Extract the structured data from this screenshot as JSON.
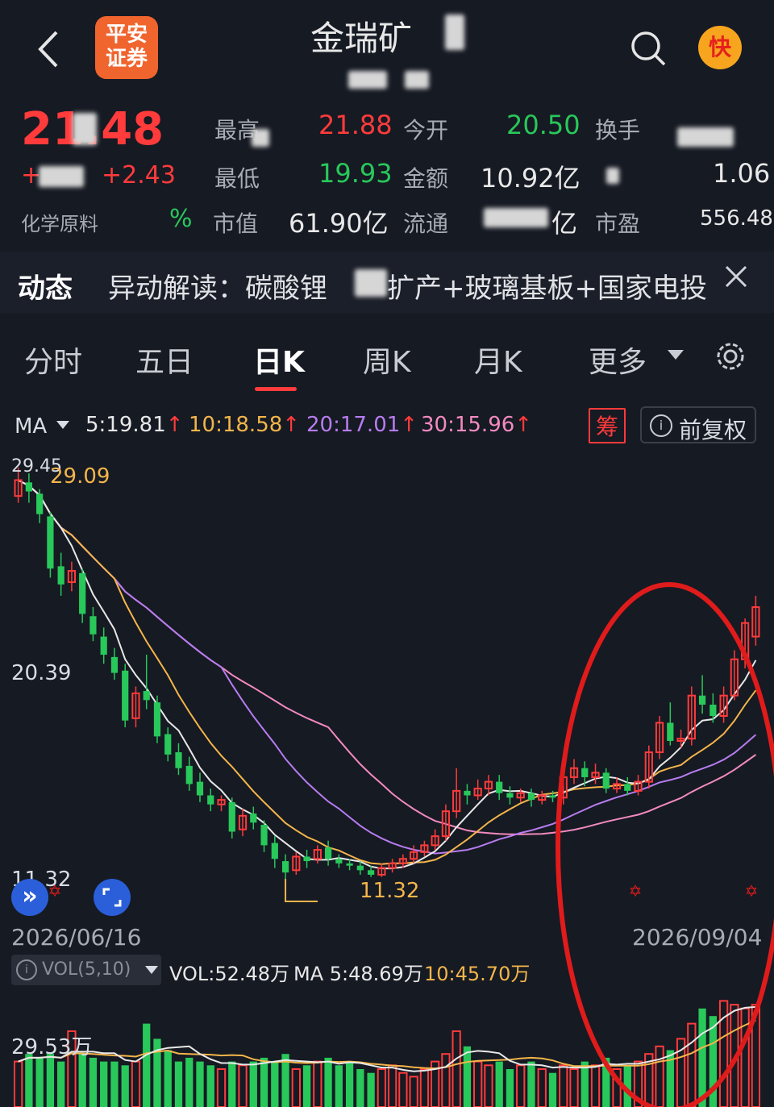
{
  "header": {
    "back_icon": "chevron-left-icon",
    "broker_logo_text": "平安\n证券",
    "title": "金瑞矿",
    "search_icon": "search-icon",
    "fast_badge": "快"
  },
  "quote": {
    "price": "21.48",
    "change": "+2.43",
    "industry": "化学原料",
    "industry_change": "%",
    "high_label": "最高",
    "high_value": "21.88",
    "low_label": "最低",
    "low_value": "19.93",
    "market_cap_label": "市值",
    "market_cap_value": "61.90亿",
    "open_label": "今开",
    "open_value": "20.50",
    "amount_label": "金额",
    "amount_value": "10.92亿",
    "float_label": "流通",
    "float_value": "亿",
    "turnover_label": "换手",
    "ratio_value": "1.06",
    "pe_label": "市盈",
    "pe_value": "556.48"
  },
  "news": {
    "label": "动态",
    "text": "异动解读：碳酸锂",
    "text2": "扩产+玻璃基板+国家电投",
    "close_icon": "close-icon"
  },
  "tabs": [
    {
      "label": "分时"
    },
    {
      "label": "五日"
    },
    {
      "label": "日K"
    },
    {
      "label": "周K"
    },
    {
      "label": "月K"
    },
    {
      "label": "更多"
    }
  ],
  "settings_icon": "gear-icon",
  "ma_bar": {
    "label": "MA",
    "ma5": "5:19.81",
    "ma10": "10:18.58",
    "ma20": "20:17.01",
    "ma30": "30:15.96",
    "chip_button": "筹",
    "adjust_button": "前复权",
    "colors": {
      "ma5": "#e8e8e8",
      "ma10": "#f4b54a",
      "ma20": "#b77cf0",
      "ma30": "#f38ac0"
    }
  },
  "chart_labels": {
    "top_value": "29.45",
    "high_marker": "29.09",
    "mid_axis": "20.39",
    "bottom_axis": "11.32",
    "low_marker": "11.32",
    "start_date": "2026/06/16",
    "end_date": "2026/09/04"
  },
  "volume_bar": {
    "indicator": "VOL(5,10)",
    "vol": "VOL:52.48万",
    "ma5": "MA 5:48.69万",
    "ma10": "10:45.70万",
    "axis_top": "29.53万"
  },
  "chart_data": {
    "type": "candlestick",
    "ylim": [
      11.32,
      29.45
    ],
    "candles": [
      {
        "o": 28.2,
        "c": 28.9,
        "h": 29.45,
        "l": 27.9
      },
      {
        "o": 28.8,
        "c": 28.4,
        "h": 29.2,
        "l": 27.9
      },
      {
        "o": 28.3,
        "c": 27.4,
        "h": 28.5,
        "l": 27.0
      },
      {
        "o": 27.3,
        "c": 25.0,
        "h": 27.5,
        "l": 24.6
      },
      {
        "o": 25.1,
        "c": 24.3,
        "h": 25.7,
        "l": 23.8
      },
      {
        "o": 24.4,
        "c": 24.9,
        "h": 25.3,
        "l": 24.0
      },
      {
        "o": 24.8,
        "c": 23.0,
        "h": 25.0,
        "l": 22.6
      },
      {
        "o": 22.9,
        "c": 22.1,
        "h": 23.3,
        "l": 21.8
      },
      {
        "o": 22.0,
        "c": 21.2,
        "h": 22.4,
        "l": 20.8
      },
      {
        "o": 21.1,
        "c": 20.4,
        "h": 21.5,
        "l": 20.1
      },
      {
        "o": 20.5,
        "c": 18.3,
        "h": 20.8,
        "l": 18.0
      },
      {
        "o": 18.4,
        "c": 19.5,
        "h": 19.8,
        "l": 18.0
      },
      {
        "o": 19.6,
        "c": 19.2,
        "h": 21.2,
        "l": 18.8
      },
      {
        "o": 19.1,
        "c": 17.6,
        "h": 19.4,
        "l": 17.3
      },
      {
        "o": 17.7,
        "c": 16.8,
        "h": 18.0,
        "l": 16.5
      },
      {
        "o": 16.9,
        "c": 16.2,
        "h": 17.3,
        "l": 15.9
      },
      {
        "o": 16.3,
        "c": 15.5,
        "h": 16.7,
        "l": 15.2
      },
      {
        "o": 15.6,
        "c": 15.0,
        "h": 16.0,
        "l": 14.7
      },
      {
        "o": 15.0,
        "c": 14.6,
        "h": 15.3,
        "l": 14.3
      },
      {
        "o": 14.6,
        "c": 14.8,
        "h": 15.0,
        "l": 14.3
      },
      {
        "o": 14.7,
        "c": 13.4,
        "h": 14.9,
        "l": 13.1
      },
      {
        "o": 13.5,
        "c": 14.1,
        "h": 14.4,
        "l": 13.2
      },
      {
        "o": 14.2,
        "c": 13.8,
        "h": 14.5,
        "l": 13.5
      },
      {
        "o": 13.7,
        "c": 12.8,
        "h": 13.9,
        "l": 12.5
      },
      {
        "o": 12.9,
        "c": 12.2,
        "h": 13.2,
        "l": 11.8
      },
      {
        "o": 12.1,
        "c": 11.6,
        "h": 12.4,
        "l": 11.32
      },
      {
        "o": 11.7,
        "c": 12.3,
        "h": 12.5,
        "l": 11.5
      },
      {
        "o": 12.3,
        "c": 12.1,
        "h": 12.6,
        "l": 11.8
      },
      {
        "o": 12.2,
        "c": 12.6,
        "h": 12.8,
        "l": 12.0
      },
      {
        "o": 12.7,
        "c": 12.2,
        "h": 13.0,
        "l": 11.9
      },
      {
        "o": 12.2,
        "c": 12.0,
        "h": 12.4,
        "l": 11.8
      },
      {
        "o": 12.0,
        "c": 11.9,
        "h": 12.2,
        "l": 11.7
      },
      {
        "o": 11.9,
        "c": 11.7,
        "h": 12.1,
        "l": 11.5
      },
      {
        "o": 11.7,
        "c": 11.5,
        "h": 11.9,
        "l": 11.4
      },
      {
        "o": 11.5,
        "c": 11.8,
        "h": 12.0,
        "l": 11.4
      },
      {
        "o": 11.8,
        "c": 12.0,
        "h": 12.2,
        "l": 11.6
      },
      {
        "o": 12.0,
        "c": 12.2,
        "h": 12.4,
        "l": 11.8
      },
      {
        "o": 12.2,
        "c": 12.5,
        "h": 12.8,
        "l": 12.0
      },
      {
        "o": 12.5,
        "c": 12.8,
        "h": 13.0,
        "l": 12.3
      },
      {
        "o": 12.8,
        "c": 13.2,
        "h": 13.5,
        "l": 12.6
      },
      {
        "o": 13.2,
        "c": 14.3,
        "h": 14.6,
        "l": 13.0
      },
      {
        "o": 14.3,
        "c": 15.2,
        "h": 16.2,
        "l": 14.0
      },
      {
        "o": 15.2,
        "c": 15.0,
        "h": 15.5,
        "l": 14.6
      },
      {
        "o": 15.0,
        "c": 15.3,
        "h": 15.7,
        "l": 14.8
      },
      {
        "o": 15.3,
        "c": 15.6,
        "h": 15.9,
        "l": 15.0
      },
      {
        "o": 15.6,
        "c": 15.1,
        "h": 15.9,
        "l": 14.8
      },
      {
        "o": 15.1,
        "c": 14.9,
        "h": 15.4,
        "l": 14.6
      },
      {
        "o": 14.9,
        "c": 15.1,
        "h": 15.3,
        "l": 14.7
      },
      {
        "o": 15.1,
        "c": 14.8,
        "h": 15.3,
        "l": 14.5
      },
      {
        "o": 14.8,
        "c": 15.0,
        "h": 15.2,
        "l": 14.6
      },
      {
        "o": 15.0,
        "c": 14.9,
        "h": 15.2,
        "l": 14.7
      },
      {
        "o": 14.9,
        "c": 15.8,
        "h": 16.2,
        "l": 14.6
      },
      {
        "o": 15.8,
        "c": 16.2,
        "h": 16.6,
        "l": 15.5
      },
      {
        "o": 16.2,
        "c": 15.8,
        "h": 16.5,
        "l": 15.4
      },
      {
        "o": 15.8,
        "c": 16.0,
        "h": 16.4,
        "l": 15.5
      },
      {
        "o": 16.0,
        "c": 15.3,
        "h": 16.2,
        "l": 15.1
      },
      {
        "o": 15.3,
        "c": 15.5,
        "h": 15.8,
        "l": 15.1
      },
      {
        "o": 15.5,
        "c": 15.2,
        "h": 15.8,
        "l": 15.0
      },
      {
        "o": 15.2,
        "c": 15.6,
        "h": 15.9,
        "l": 15.0
      },
      {
        "o": 15.6,
        "c": 16.9,
        "h": 17.2,
        "l": 15.3
      },
      {
        "o": 16.9,
        "c": 18.2,
        "h": 18.5,
        "l": 16.6
      },
      {
        "o": 18.2,
        "c": 17.4,
        "h": 19.1,
        "l": 17.2
      },
      {
        "o": 17.4,
        "c": 17.5,
        "h": 17.9,
        "l": 17.1
      },
      {
        "o": 17.5,
        "c": 19.4,
        "h": 19.8,
        "l": 17.2
      },
      {
        "o": 19.4,
        "c": 19.0,
        "h": 20.3,
        "l": 18.6
      },
      {
        "o": 19.0,
        "c": 18.5,
        "h": 19.5,
        "l": 18.2
      },
      {
        "o": 18.5,
        "c": 19.4,
        "h": 19.8,
        "l": 18.2
      },
      {
        "o": 19.4,
        "c": 21.0,
        "h": 21.4,
        "l": 19.2
      },
      {
        "o": 21.0,
        "c": 22.6,
        "h": 22.8,
        "l": 20.6
      },
      {
        "o": 22.0,
        "c": 23.3,
        "h": 23.8,
        "l": 21.6
      }
    ],
    "volumes": [
      12,
      14,
      13,
      14,
      12,
      20,
      14,
      13,
      12,
      12,
      11,
      12,
      22,
      18,
      15,
      12,
      13,
      12,
      11,
      10,
      12,
      11,
      12,
      13,
      12,
      14,
      10,
      11,
      12,
      13,
      11,
      12,
      10,
      9,
      10,
      11,
      9,
      8,
      10,
      12,
      14,
      20,
      16,
      12,
      11,
      12,
      10,
      11,
      12,
      10,
      9,
      11,
      10,
      12,
      11,
      13,
      10,
      11,
      12,
      14,
      16,
      15,
      18,
      22,
      26,
      24,
      28,
      27,
      26,
      27
    ],
    "ma_series": [
      "MA5",
      "MA10",
      "MA20",
      "MA30"
    ]
  }
}
